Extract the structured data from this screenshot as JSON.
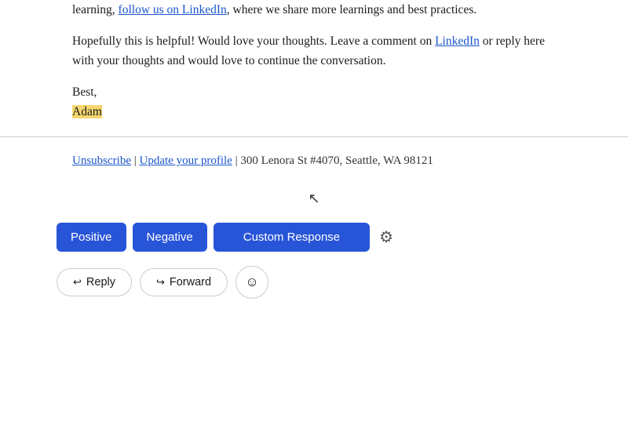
{
  "email": {
    "top_paragraph": "learning, follow us on LinkedIn, where we share more learnings and best practices.",
    "top_link_text": "follow us on LinkedIn",
    "middle_paragraph": "Hopefully this is helpful! Would love your thoughts. Leave a comment on LinkedIn or reply here with your thoughts and would love to continue the conversation.",
    "middle_link_text": "LinkedIn",
    "sign_off": "Best,",
    "name": "Adam"
  },
  "footer": {
    "unsubscribe_text": "Unsubscribe",
    "pipe": "|",
    "update_profile_text": "Update your profile",
    "address": "| 300 Lenora St #4070, Seattle, WA 98121"
  },
  "action_buttons": {
    "positive_label": "Positive",
    "negative_label": "Negative",
    "custom_response_label": "Custom Response"
  },
  "reply_forward": {
    "reply_label": "Reply",
    "forward_label": "Forward"
  }
}
